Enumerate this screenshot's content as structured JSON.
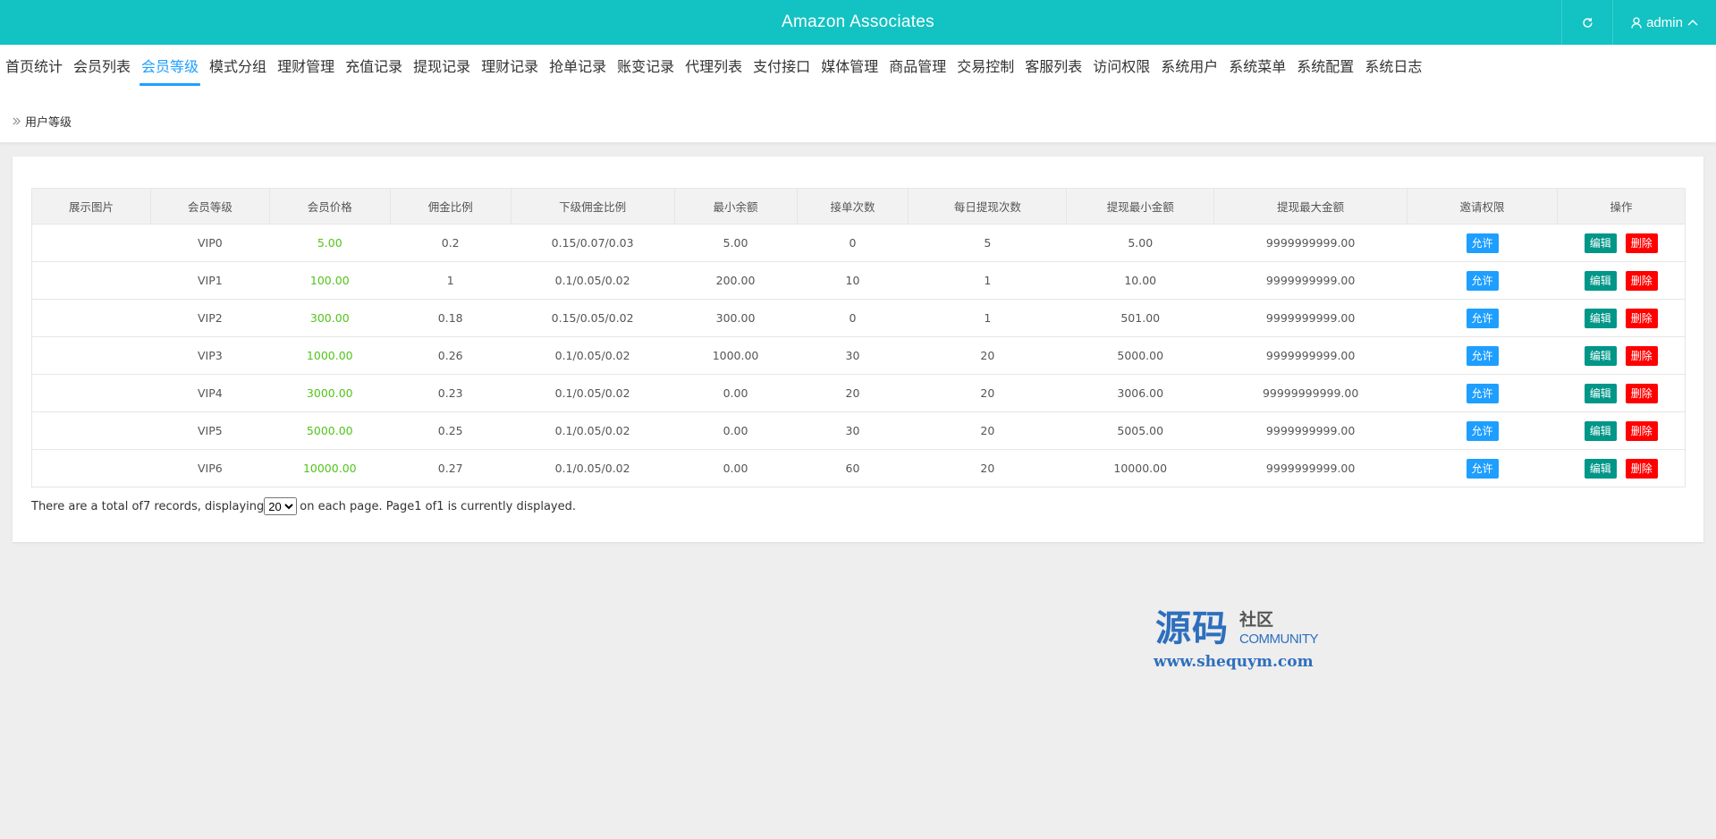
{
  "header": {
    "title": "Amazon Associates",
    "user": "admin"
  },
  "nav": {
    "items": [
      "首页统计",
      "会员列表",
      "会员等级",
      "模式分组",
      "理财管理",
      "充值记录",
      "提现记录",
      "理财记录",
      "抢单记录",
      "账变记录",
      "代理列表",
      "支付接口",
      "媒体管理",
      "商品管理",
      "交易控制",
      "客服列表",
      "访问权限",
      "系统用户",
      "系统菜单",
      "系统配置",
      "系统日志"
    ],
    "active_index": 2
  },
  "breadcrumb": "用户等级",
  "table": {
    "columns": [
      "展示图片",
      "会员等级",
      "会员价格",
      "佣金比例",
      "下级佣金比例",
      "最小余额",
      "接单次数",
      "每日提现次数",
      "提现最小金额",
      "提现最大金额",
      "邀请权限",
      "操作"
    ],
    "rows": [
      {
        "level": "VIP0",
        "price": "5.00",
        "commission": "0.2",
        "sub_commission": "0.15/0.07/0.03",
        "min_balance": "5.00",
        "orders": "0",
        "daily_withdraw": "5",
        "withdraw_min": "5.00",
        "withdraw_max": "9999999999.00"
      },
      {
        "level": "VIP1",
        "price": "100.00",
        "commission": "1",
        "sub_commission": "0.1/0.05/0.02",
        "min_balance": "200.00",
        "orders": "10",
        "daily_withdraw": "1",
        "withdraw_min": "10.00",
        "withdraw_max": "9999999999.00"
      },
      {
        "level": "VIP2",
        "price": "300.00",
        "commission": "0.18",
        "sub_commission": "0.15/0.05/0.02",
        "min_balance": "300.00",
        "orders": "0",
        "daily_withdraw": "1",
        "withdraw_min": "501.00",
        "withdraw_max": "9999999999.00"
      },
      {
        "level": "VIP3",
        "price": "1000.00",
        "commission": "0.26",
        "sub_commission": "0.1/0.05/0.02",
        "min_balance": "1000.00",
        "orders": "30",
        "daily_withdraw": "20",
        "withdraw_min": "5000.00",
        "withdraw_max": "9999999999.00"
      },
      {
        "level": "VIP4",
        "price": "3000.00",
        "commission": "0.23",
        "sub_commission": "0.1/0.05/0.02",
        "min_balance": "0.00",
        "orders": "20",
        "daily_withdraw": "20",
        "withdraw_min": "3006.00",
        "withdraw_max": "99999999999.00"
      },
      {
        "level": "VIP5",
        "price": "5000.00",
        "commission": "0.25",
        "sub_commission": "0.1/0.05/0.02",
        "min_balance": "0.00",
        "orders": "30",
        "daily_withdraw": "20",
        "withdraw_min": "5005.00",
        "withdraw_max": "9999999999.00"
      },
      {
        "level": "VIP6",
        "price": "10000.00",
        "commission": "0.27",
        "sub_commission": "0.1/0.05/0.02",
        "min_balance": "0.00",
        "orders": "60",
        "daily_withdraw": "20",
        "withdraw_min": "10000.00",
        "withdraw_max": "9999999999.00"
      }
    ],
    "allow_label": "允许",
    "edit_label": "编辑",
    "delete_label": "删除"
  },
  "pager": {
    "prefix": "There are a total of7 records, displaying",
    "page_size": "20",
    "suffix": "on each page. Page1 of1 is currently displayed."
  },
  "watermark": {
    "big": "源码",
    "small": "社区",
    "community": "COMMUNITY",
    "url": "www.shequym.com"
  },
  "colors": {
    "header_bg": "#13c2c2",
    "active_nav": "#1e9fff",
    "price": "#52c41a",
    "allow_btn": "#1e9fff",
    "edit_btn": "#009688",
    "delete_btn": "#ff0000"
  },
  "icons": {
    "refresh": "refresh-icon",
    "user": "user-icon",
    "caret": "chevron-up-icon",
    "breadcrumb": "double-chevron-right-icon"
  }
}
